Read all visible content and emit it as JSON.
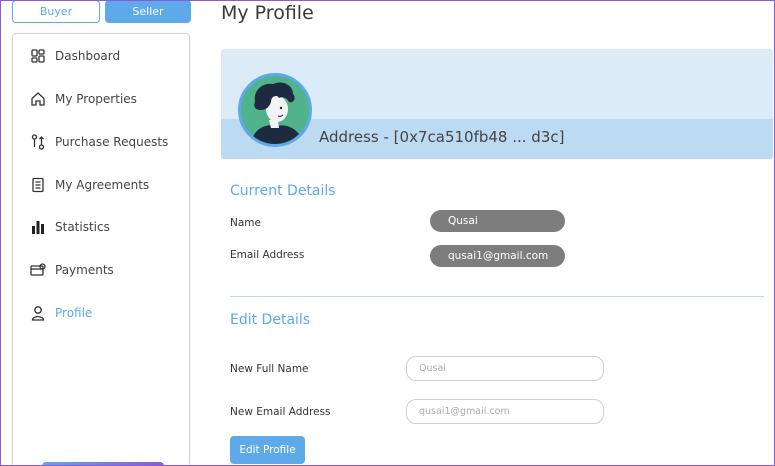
{
  "roles": {
    "buyer": "Buyer",
    "seller": "Seller",
    "active": "Seller"
  },
  "sidebar": {
    "items": [
      {
        "label": "Dashboard",
        "icon": "dashboard-icon"
      },
      {
        "label": "My Properties",
        "icon": "home-icon"
      },
      {
        "label": "Purchase Requests",
        "icon": "transfer-icon"
      },
      {
        "label": "My Agreements",
        "icon": "document-icon"
      },
      {
        "label": "Statistics",
        "icon": "bar-chart-icon"
      },
      {
        "label": "Payments",
        "icon": "payment-icon"
      },
      {
        "label": "Profile",
        "icon": "user-icon"
      }
    ],
    "active": "Profile"
  },
  "page": {
    "title": "My Profile"
  },
  "banner": {
    "address": "Address - [0x7ca510fb48 ... d3c]"
  },
  "current_details": {
    "title": "Current Details",
    "name_label": "Name",
    "name_value": "Qusai",
    "email_label": "Email Address",
    "email_value": "qusai1@gmail.com"
  },
  "edit_details": {
    "title": "Edit Details",
    "name_label": "New Full Name",
    "name_placeholder": "Qusai",
    "email_label": "New Email Address",
    "email_placeholder": "qusai1@gmail.com",
    "submit_label": "Edit Profile"
  },
  "colors": {
    "accent": "#5da9e9",
    "pill": "#7d7d7d",
    "banner": "#dcebf8",
    "banner_strip": "#bcdaf2"
  }
}
